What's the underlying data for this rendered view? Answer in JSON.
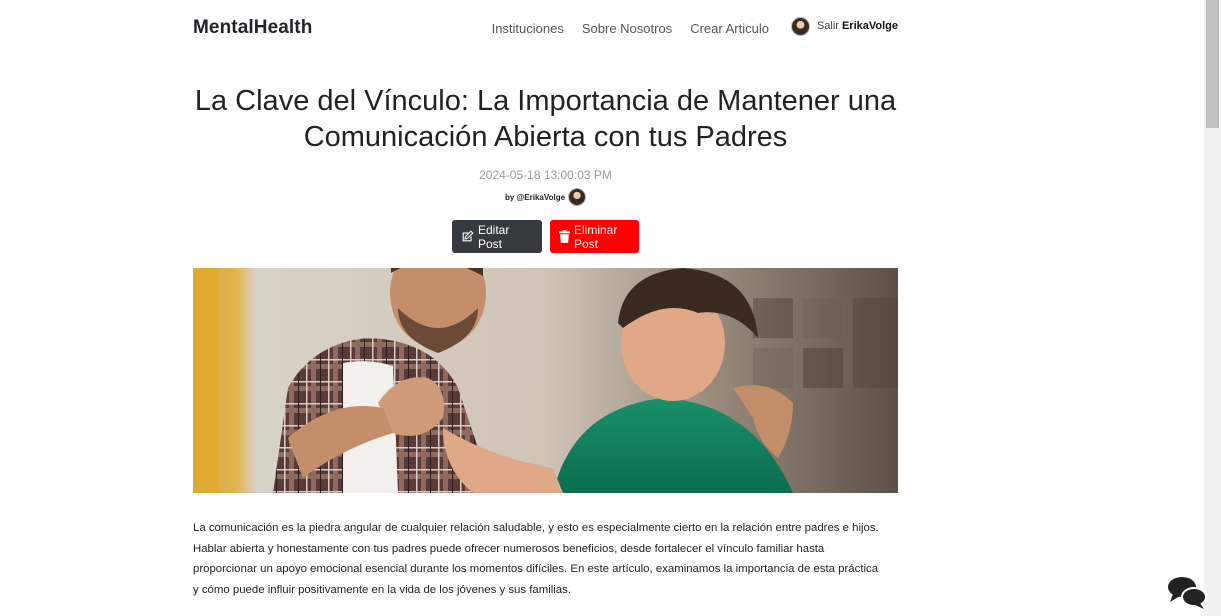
{
  "nav": {
    "brand": "MentalHealth",
    "links": [
      "Instituciones",
      "Sobre Nosotros",
      "Crear Articulo"
    ],
    "logout_label": "Salir",
    "username": "ErikaVolge"
  },
  "post": {
    "title": "La Clave del Vínculo: La Importancia de Mantener una Comunicación Abierta con tus Padres",
    "date": "2024-05-18 13:00:03 PM",
    "byline": "by @ErikaVolge",
    "edit_label": "Editar Post",
    "delete_label": "Eliminar Post",
    "body": "La comunicación es la piedra angular de cualquier relación saludable, y esto es especialmente cierto en la relación entre padres e hijos. Hablar abierta y honestamente con tus padres puede ofrecer numerosos beneficios, desde fortalecer el vínculo familiar hasta proporcionar un apoyo emocional esencial durante los momentos difíciles. En este artículo, examinamos la importancia de esta práctica y cómo puede influir positivamente en la vida de los jóvenes y sus familias."
  },
  "icons": {
    "edit": "pencil-square-icon",
    "delete": "trash-icon",
    "chat": "chat-bubbles-icon"
  },
  "colors": {
    "edit_button": "#343a40",
    "delete_button": "#ff0000"
  }
}
